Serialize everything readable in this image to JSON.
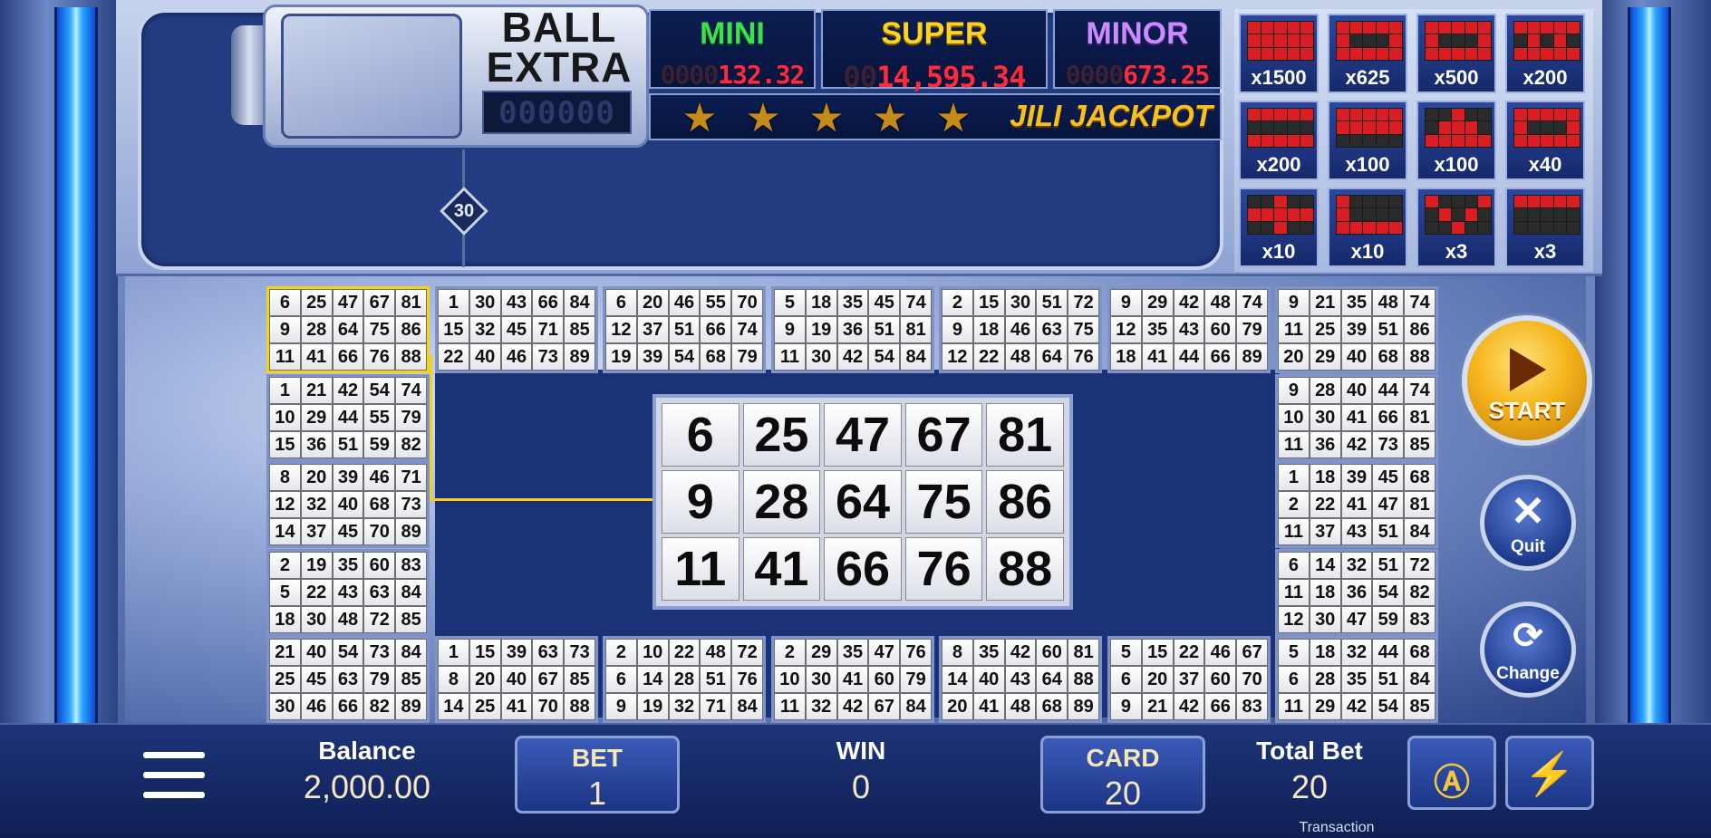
{
  "ball_extra": {
    "title_line1": "BALL",
    "title_line2": "EXTRA",
    "counter": "000000",
    "current_ball": "30"
  },
  "jackpots": [
    {
      "label": "MINI",
      "value_dim": "0000",
      "value": "132.32",
      "color": "#3ee04a"
    },
    {
      "label": "SUPER",
      "value_dim": "00",
      "value": "14,595.34",
      "color": "#ffd21f"
    },
    {
      "label": "MINOR",
      "value_dim": "0000",
      "value": "673.25",
      "color": "#c98bff"
    }
  ],
  "jackpot_banner": "JILI JACKPOT",
  "paytable": [
    {
      "mult": "x1500",
      "pattern": [
        1,
        1,
        1,
        1,
        1,
        1,
        1,
        1,
        1,
        1,
        1,
        1,
        1,
        1,
        1
      ]
    },
    {
      "mult": "x625",
      "pattern": [
        1,
        1,
        1,
        1,
        1,
        1,
        0,
        0,
        0,
        1,
        1,
        1,
        1,
        1,
        1
      ]
    },
    {
      "mult": "x500",
      "pattern": [
        1,
        1,
        1,
        1,
        1,
        1,
        0,
        0,
        0,
        1,
        1,
        1,
        1,
        1,
        1
      ]
    },
    {
      "mult": "x200",
      "pattern": [
        1,
        1,
        1,
        1,
        1,
        0,
        1,
        0,
        1,
        0,
        1,
        1,
        1,
        1,
        1
      ]
    },
    {
      "mult": "x200",
      "pattern": [
        1,
        1,
        1,
        1,
        1,
        0,
        0,
        0,
        0,
        0,
        1,
        1,
        1,
        1,
        1
      ]
    },
    {
      "mult": "x100",
      "pattern": [
        1,
        1,
        1,
        1,
        1,
        1,
        1,
        1,
        1,
        1,
        0,
        0,
        0,
        0,
        0
      ]
    },
    {
      "mult": "x100",
      "pattern": [
        0,
        0,
        1,
        0,
        0,
        0,
        1,
        1,
        1,
        0,
        1,
        1,
        1,
        1,
        1
      ]
    },
    {
      "mult": "x40",
      "pattern": [
        1,
        1,
        1,
        1,
        1,
        1,
        0,
        0,
        0,
        1,
        1,
        1,
        1,
        1,
        1
      ]
    },
    {
      "mult": "x10",
      "pattern": [
        0,
        0,
        1,
        0,
        0,
        1,
        1,
        1,
        1,
        1,
        0,
        0,
        1,
        0,
        0
      ]
    },
    {
      "mult": "x10",
      "pattern": [
        1,
        0,
        0,
        0,
        0,
        1,
        0,
        0,
        0,
        0,
        1,
        1,
        1,
        1,
        1
      ]
    },
    {
      "mult": "x3",
      "pattern": [
        1,
        0,
        0,
        0,
        1,
        0,
        1,
        0,
        1,
        0,
        0,
        0,
        1,
        0,
        0
      ]
    },
    {
      "mult": "x3",
      "pattern": [
        1,
        1,
        1,
        1,
        1,
        0,
        0,
        0,
        0,
        0,
        0,
        0,
        0,
        0,
        0
      ]
    }
  ],
  "cards": [
    [
      6,
      25,
      47,
      67,
      81,
      9,
      28,
      64,
      75,
      86,
      11,
      41,
      66,
      76,
      88
    ],
    [
      1,
      30,
      43,
      66,
      84,
      15,
      32,
      45,
      71,
      85,
      22,
      40,
      46,
      73,
      89
    ],
    [
      6,
      20,
      46,
      55,
      70,
      12,
      37,
      51,
      66,
      74,
      19,
      39,
      54,
      68,
      79
    ],
    [
      5,
      18,
      35,
      45,
      74,
      9,
      19,
      36,
      51,
      81,
      11,
      30,
      42,
      54,
      84
    ],
    [
      2,
      15,
      30,
      51,
      72,
      9,
      18,
      46,
      63,
      75,
      12,
      22,
      48,
      64,
      76
    ],
    [
      9,
      29,
      42,
      48,
      74,
      12,
      35,
      43,
      60,
      79,
      18,
      41,
      44,
      66,
      89
    ],
    [
      9,
      21,
      35,
      48,
      74,
      11,
      25,
      39,
      51,
      86,
      20,
      29,
      40,
      68,
      88
    ],
    [
      1,
      21,
      42,
      54,
      74,
      10,
      29,
      44,
      55,
      79,
      15,
      36,
      51,
      59,
      82
    ],
    [
      9,
      28,
      40,
      44,
      74,
      10,
      30,
      41,
      66,
      81,
      11,
      36,
      42,
      73,
      85
    ],
    [
      8,
      20,
      39,
      46,
      71,
      12,
      32,
      40,
      68,
      73,
      14,
      37,
      45,
      70,
      89
    ],
    [
      1,
      18,
      39,
      45,
      68,
      2,
      22,
      41,
      47,
      81,
      11,
      37,
      43,
      51,
      84
    ],
    [
      2,
      19,
      35,
      60,
      83,
      5,
      22,
      43,
      63,
      84,
      18,
      30,
      48,
      72,
      85
    ],
    [
      6,
      14,
      32,
      51,
      72,
      11,
      18,
      36,
      54,
      82,
      12,
      30,
      47,
      59,
      83
    ],
    [
      21,
      40,
      54,
      73,
      84,
      25,
      45,
      63,
      79,
      85,
      30,
      46,
      66,
      82,
      89
    ],
    [
      1,
      15,
      39,
      63,
      73,
      8,
      20,
      40,
      67,
      85,
      14,
      25,
      41,
      70,
      88
    ],
    [
      2,
      10,
      22,
      48,
      72,
      6,
      14,
      28,
      51,
      76,
      9,
      19,
      32,
      71,
      84
    ],
    [
      2,
      29,
      35,
      47,
      76,
      10,
      30,
      41,
      60,
      79,
      11,
      32,
      42,
      67,
      84
    ],
    [
      8,
      35,
      42,
      60,
      81,
      14,
      40,
      43,
      64,
      88,
      20,
      41,
      48,
      68,
      89
    ],
    [
      5,
      15,
      22,
      46,
      67,
      6,
      20,
      37,
      60,
      70,
      9,
      21,
      42,
      66,
      83
    ],
    [
      5,
      18,
      32,
      44,
      68,
      6,
      28,
      35,
      51,
      84,
      11,
      29,
      42,
      54,
      85
    ]
  ],
  "selected_card": [
    6,
    25,
    47,
    67,
    81,
    9,
    28,
    64,
    75,
    86,
    11,
    41,
    66,
    76,
    88
  ],
  "controls": {
    "start": "START",
    "quit": "Quit",
    "change": "Change"
  },
  "bottom": {
    "balance_label": "Balance",
    "balance": "2,000.00",
    "bet_label": "BET",
    "bet": "1",
    "win_label": "WIN",
    "win": "0",
    "card_label": "CARD",
    "card": "20",
    "total_bet_label": "Total Bet",
    "total_bet": "20",
    "transaction": "Transaction"
  }
}
